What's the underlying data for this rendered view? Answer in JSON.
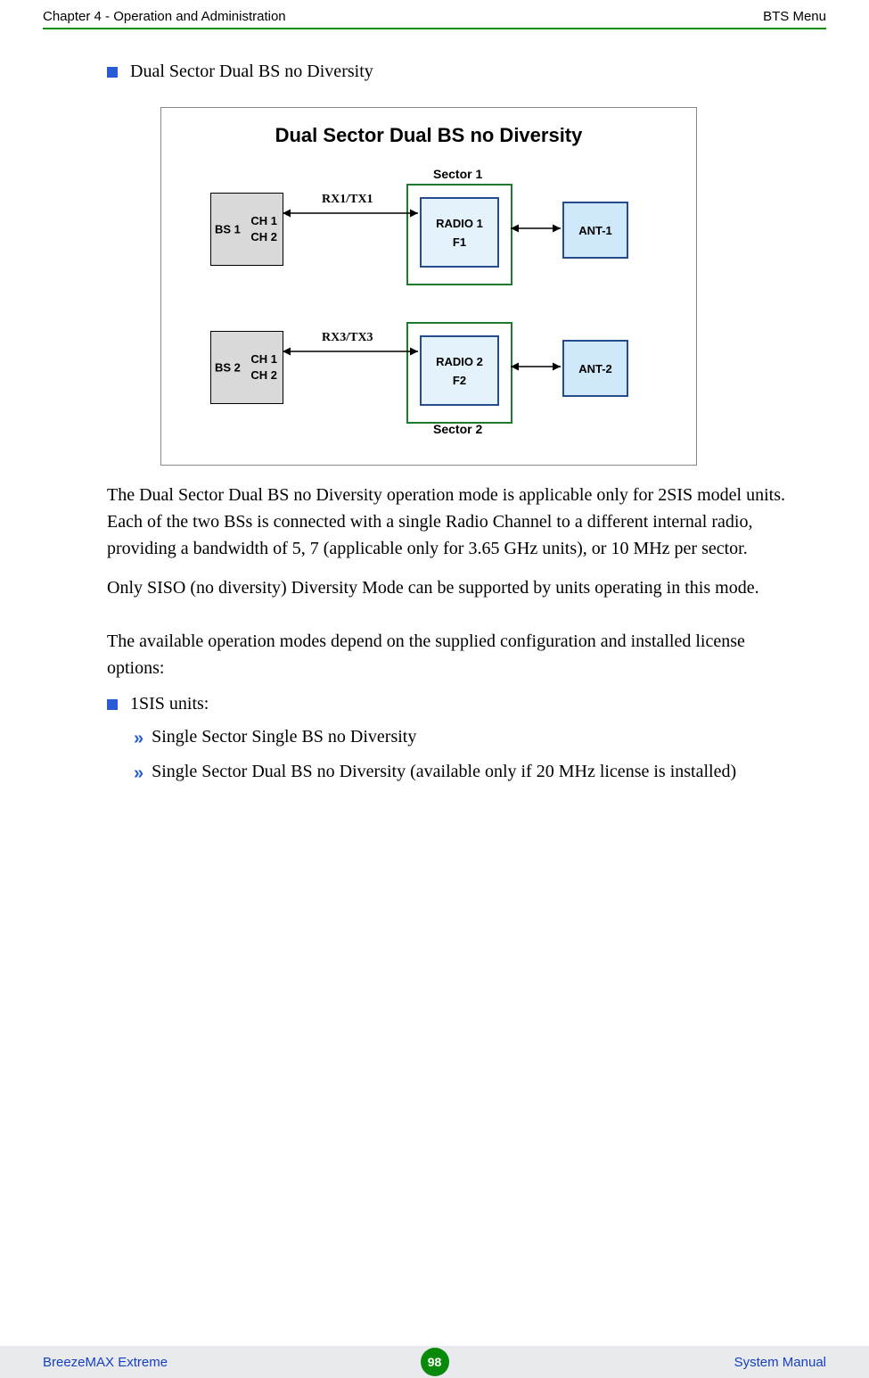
{
  "header": {
    "left": "Chapter 4 - Operation and Administration",
    "right": "BTS Menu"
  },
  "section": {
    "bullet_title": "Dual Sector Dual BS no Diversity"
  },
  "diagram": {
    "title": "Dual Sector Dual BS no Diversity",
    "bs1": {
      "side": "BS 1",
      "ch1": "CH 1",
      "ch2": "CH 2"
    },
    "bs2": {
      "side": "BS 2",
      "ch1": "CH 1",
      "ch2": "CH 2"
    },
    "link1": "RX1/TX1",
    "link2": "RX3/TX3",
    "sector1_label": "Sector 1",
    "sector2_label": "Sector 2",
    "radio1": {
      "name": "RADIO 1",
      "freq": "F1"
    },
    "radio2": {
      "name": "RADIO 2",
      "freq": "F2"
    },
    "ant1": "ANT-1",
    "ant2": "ANT-2"
  },
  "paragraphs": {
    "p1": "The Dual Sector Dual BS no Diversity operation mode is applicable only for 2SIS model units. Each of the two BSs is connected with a single Radio Channel to a different internal radio, providing a bandwidth of 5, 7 (applicable only for 3.65 GHz units), or 10 MHz per sector.",
    "p2": "Only SISO (no diversity) Diversity Mode can be supported by units operating in this mode.",
    "p3": "The available operation modes depend on the supplied configuration and installed license options:"
  },
  "list": {
    "unit_type": "1SIS units:",
    "sub1": "Single Sector Single BS no Diversity",
    "sub2": "Single Sector Dual BS no Diversity (available only if 20 MHz license is installed)"
  },
  "footer": {
    "left": "BreezeMAX Extreme",
    "page": "98",
    "right": "System Manual"
  }
}
